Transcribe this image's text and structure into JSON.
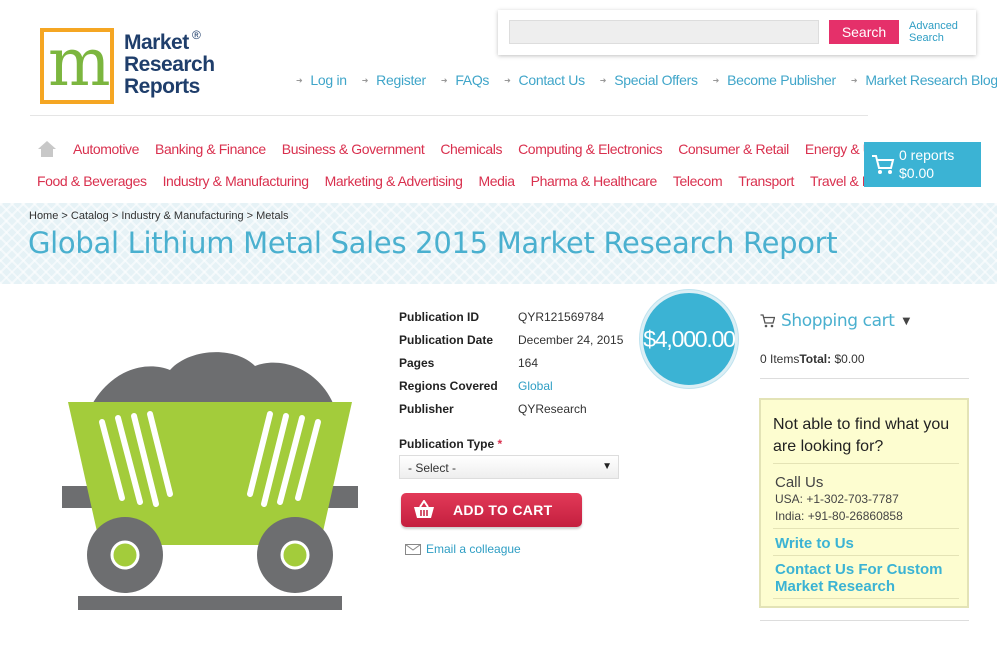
{
  "logo": {
    "lines": [
      "Market",
      "Research",
      "Reports"
    ],
    "mark": "m",
    "reg": "®"
  },
  "search": {
    "placeholder": "",
    "button": "Search",
    "advanced_line1": "Advanced",
    "advanced_line2": "Search"
  },
  "top_links": [
    "Log in",
    "Register",
    "FAQs",
    "Contact Us",
    "Special Offers",
    "Become Publisher",
    "Market Research Blog"
  ],
  "categories_row1": [
    "Automotive",
    "Banking & Finance",
    "Business & Government",
    "Chemicals",
    "Computing & Electronics",
    "Consumer & Retail",
    "Energy & Utilities"
  ],
  "categories_row2": [
    "Food & Beverages",
    "Industry & Manufacturing",
    "Marketing & Advertising",
    "Media",
    "Pharma & Healthcare",
    "Telecom",
    "Transport",
    "Travel & Leisure"
  ],
  "cart_widget": {
    "count": "0 reports",
    "total": "$0.00"
  },
  "breadcrumb": "Home > Catalog > Industry & Manufacturing > Metals",
  "title": "Global Lithium Metal Sales 2015 Market Research Report",
  "details": [
    {
      "label": "Publication ID",
      "value": "QYR121569784",
      "link": false
    },
    {
      "label": "Publication Date",
      "value": "December 24, 2015",
      "link": false
    },
    {
      "label": "Pages",
      "value": "164",
      "link": false
    },
    {
      "label": "Regions Covered",
      "value": "Global",
      "link": true
    },
    {
      "label": "Publisher",
      "value": "QYResearch",
      "link": false
    }
  ],
  "price": "$4,000.00",
  "publication_type": {
    "label": "Publication Type",
    "required": "*",
    "selected": "- Select -"
  },
  "add_to_cart": "ADD TO CART",
  "email_colleague": "Email a colleague",
  "shopping_cart": {
    "title": "Shopping cart",
    "items_text": "0 Items",
    "total_label": "Total:",
    "total_value": " $0.00"
  },
  "help": {
    "question": "Not able to find what you are looking for?",
    "call_title": "Call Us",
    "usa": "USA: +1-302-703-7787",
    "india": "India: +91-80-26860858",
    "write": "Write to Us",
    "custom": "Contact Us For Custom Market Research"
  },
  "colors": {
    "accent_blue": "#3bb3d4",
    "category_red": "#d9304e",
    "search_pink": "#e5306a",
    "help_yellow": "#fdfdd0"
  }
}
